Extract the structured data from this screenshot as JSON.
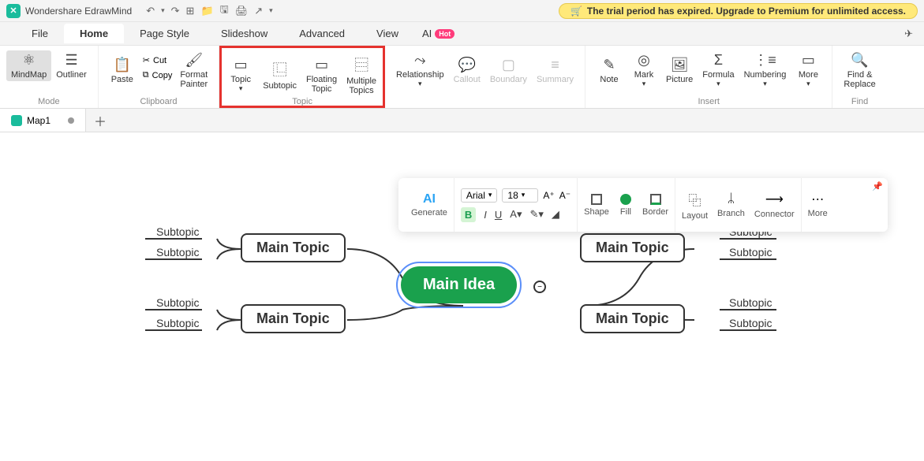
{
  "app": {
    "title": "Wondershare EdrawMind"
  },
  "banner": {
    "text": "The trial period has expired. Upgrade to Premium for unlimited access."
  },
  "menu": {
    "file": "File",
    "home": "Home",
    "pagestyle": "Page Style",
    "slideshow": "Slideshow",
    "advanced": "Advanced",
    "view": "View",
    "ai": "AI",
    "hot": "Hot"
  },
  "ribbon": {
    "mode": {
      "mindmap": "MindMap",
      "outliner": "Outliner",
      "label": "Mode"
    },
    "clipboard": {
      "paste": "Paste",
      "cut": "Cut",
      "copy": "Copy",
      "format": "Format\nPainter",
      "label": "Clipboard"
    },
    "topic": {
      "topic": "Topic",
      "subtopic": "Subtopic",
      "floating": "Floating\nTopic",
      "multiple": "Multiple\nTopics",
      "label": "Topic"
    },
    "rel": "Relationship",
    "callout": "Callout",
    "boundary": "Boundary",
    "summary": "Summary",
    "insert": {
      "note": "Note",
      "mark": "Mark",
      "picture": "Picture",
      "formula": "Formula",
      "numbering": "Numbering",
      "more": "More",
      "label": "Insert"
    },
    "find": {
      "label": "Find",
      "btn": "Find &\nReplace"
    }
  },
  "doc": {
    "tab": "Map1"
  },
  "floating": {
    "generate": "Generate",
    "ai": "AI",
    "font": "Arial",
    "size": "18",
    "shape": "Shape",
    "fill": "Fill",
    "border": "Border",
    "layout": "Layout",
    "branch": "Branch",
    "connector": "Connector",
    "more": "More"
  },
  "mindmap": {
    "main": "Main Idea",
    "maintopic": "Main Topic",
    "subtopic": "Subtopic"
  }
}
